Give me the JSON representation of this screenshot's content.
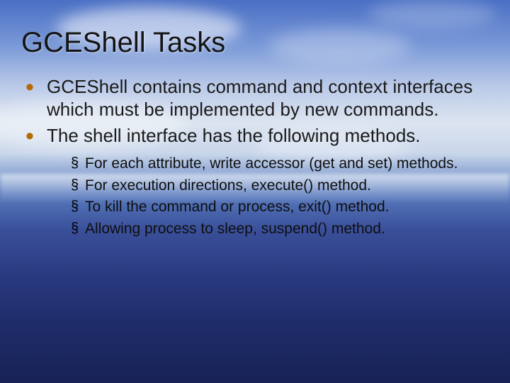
{
  "title": "GCEShell Tasks",
  "bullets": [
    "GCEShell contains command and context interfaces which must be implemented by new commands.",
    "The shell interface has the following methods."
  ],
  "subbullets": [
    "For each attribute, write accessor (get and set) methods.",
    "For execution directions, execute() method.",
    "To kill the command or process, exit() method.",
    "Allowing process to sleep, suspend() method."
  ]
}
